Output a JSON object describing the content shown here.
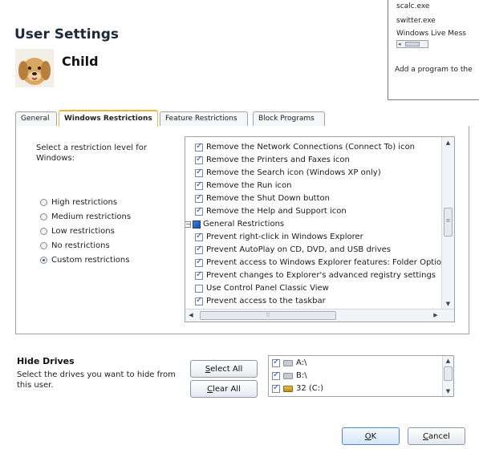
{
  "background_window": {
    "items": [
      "scalc.exe",
      "switter.exe",
      "Windows Live Mess"
    ],
    "hint": "Add a program to the"
  },
  "header": {
    "title": "User Settings",
    "user_name": "Child"
  },
  "tabs": [
    {
      "label": "General",
      "active": false
    },
    {
      "label": "Windows Restrictions",
      "active": true
    },
    {
      "label": "Feature Restrictions",
      "active": false
    },
    {
      "label": "Block Programs",
      "active": false
    }
  ],
  "restrictions": {
    "prompt": "Select a restriction level for Windows:",
    "levels": [
      {
        "label": "High restrictions",
        "selected": false
      },
      {
        "label": "Medium restrictions",
        "selected": false
      },
      {
        "label": "Low restrictions",
        "selected": false
      },
      {
        "label": "No restrictions",
        "selected": false
      },
      {
        "label": "Custom restrictions",
        "selected": true
      }
    ],
    "items": [
      {
        "label": "Remove the Network Connections (Connect To) icon",
        "checked": true
      },
      {
        "label": "Remove the Printers and Faxes icon",
        "checked": true
      },
      {
        "label": "Remove the Search icon (Windows XP only)",
        "checked": true
      },
      {
        "label": "Remove the Run icon",
        "checked": true
      },
      {
        "label": "Remove the Shut Down button",
        "checked": true
      },
      {
        "label": "Remove the Help and Support icon",
        "checked": true
      },
      {
        "label": "General Restrictions",
        "group": true
      },
      {
        "label": "Prevent right-click in Windows Explorer",
        "checked": true
      },
      {
        "label": "Prevent AutoPlay on CD, DVD, and USB drives",
        "checked": true
      },
      {
        "label": "Prevent access to Windows Explorer features: Folder Option",
        "checked": true
      },
      {
        "label": "Prevent changes to Explorer's advanced registry settings",
        "checked": true
      },
      {
        "label": "Use Control Panel Classic View",
        "checked": false
      },
      {
        "label": "Prevent access to the taskbar",
        "checked": true
      }
    ]
  },
  "drives": {
    "heading": "Hide Drives",
    "description": "Select the drives you want to hide from this user.",
    "select_all_prefix": "",
    "select_all_key": "S",
    "select_all_rest": "elect All",
    "clear_all_key": "C",
    "clear_all_rest": "lear All",
    "list": [
      {
        "label": "A:\\",
        "checked": true
      },
      {
        "label": "B:\\",
        "checked": true
      },
      {
        "label": "32 (C:)",
        "checked": true
      }
    ]
  },
  "footer": {
    "ok_key": "O",
    "ok_rest": "K",
    "cancel_key": "C",
    "cancel_rest": "ancel"
  },
  "colors": {
    "accent": "#f0b43c",
    "check": "#1d4fa8",
    "border": "#9aa4b0"
  }
}
